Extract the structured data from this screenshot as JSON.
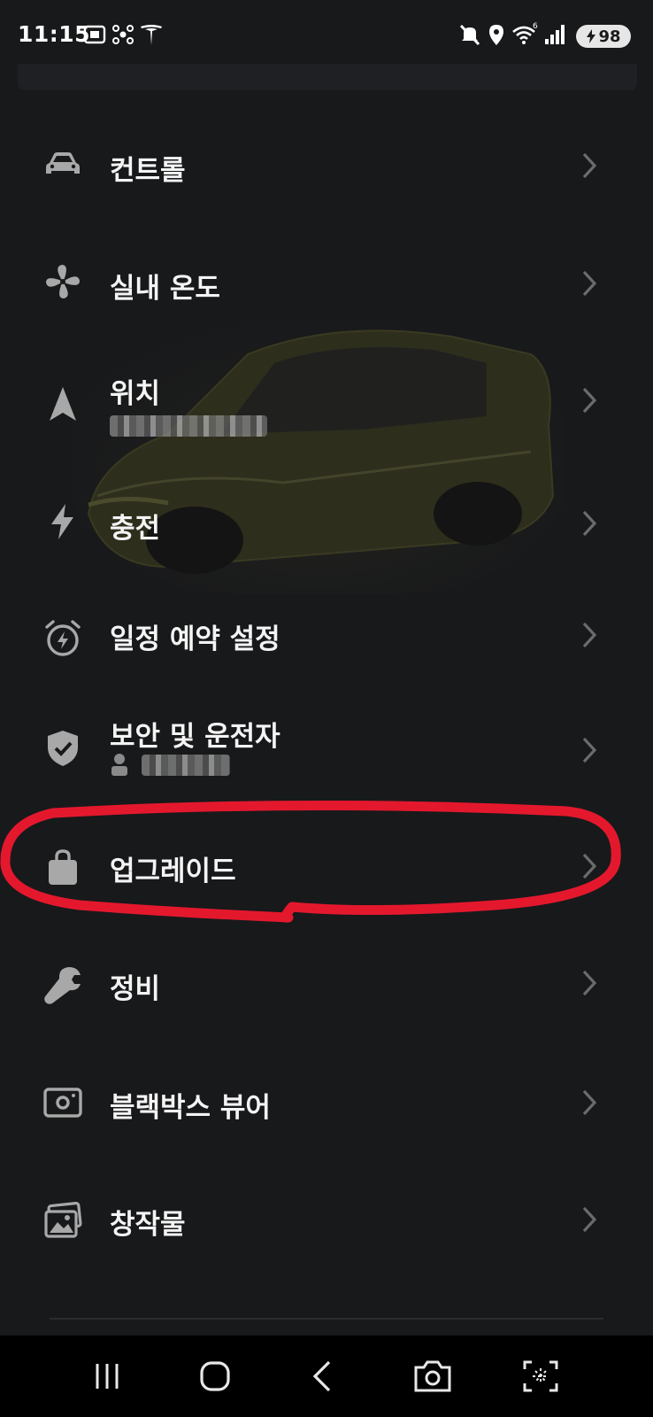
{
  "status_bar": {
    "time": "11:15",
    "battery": "98",
    "left_icons": [
      "screenshot-icon",
      "network-icon",
      "tesla-logo-icon"
    ],
    "right_icons": [
      "mute-icon",
      "location-icon",
      "wifi-6-icon",
      "signal-icon",
      "battery-charging-icon"
    ]
  },
  "menu": {
    "items": [
      {
        "label": "컨트롤",
        "icon": "car-icon"
      },
      {
        "label": "실내 온도",
        "icon": "fan-icon"
      },
      {
        "label": "위치",
        "icon": "navigation-arrow-icon"
      },
      {
        "label": "충전",
        "icon": "lightning-icon"
      },
      {
        "label": "일정 예약 설정",
        "icon": "alarm-clock-icon"
      },
      {
        "label": "보안 및 운전자",
        "icon": "shield-check-icon"
      },
      {
        "label": "업그레이드",
        "icon": "shopping-bag-icon"
      },
      {
        "label": "정비",
        "icon": "wrench-icon"
      },
      {
        "label": "블랙박스 뷰어",
        "icon": "dashcam-icon"
      },
      {
        "label": "창작물",
        "icon": "gallery-icon"
      }
    ]
  },
  "annotation": {
    "color": "#e4182d"
  },
  "nav_bar": {
    "buttons": [
      "recent-apps-icon",
      "home-icon",
      "back-icon",
      "camera-icon",
      "scan-icon"
    ]
  },
  "colors": {
    "background": "#18191b",
    "text": "#f4f4f4",
    "icon": "#a8a8a8",
    "chevron": "#6b6b6b"
  }
}
